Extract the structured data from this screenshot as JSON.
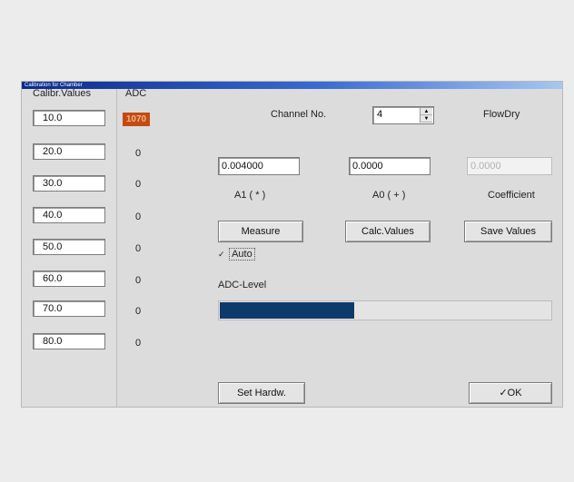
{
  "window": {
    "title": "Calibration for Chamber"
  },
  "left": {
    "header_calib": "Calibr.Values",
    "header_adc": "ADC",
    "calib_values": [
      "10.0",
      "20.0",
      "30.0",
      "40.0",
      "50.0",
      "60.0",
      "70.0",
      "80.0"
    ],
    "adc_values": [
      "1070",
      "0",
      "0",
      "0",
      "0",
      "0",
      "0",
      "0"
    ]
  },
  "channel": {
    "label": "Channel No.",
    "value": "4",
    "sensor": "FlowDry"
  },
  "coeffs": {
    "a1_value": "0.004000",
    "a0_value": "0.0000",
    "coef_value": "0.0000",
    "a1_label": "A1 ( * )",
    "a0_label": "A0 ( + )",
    "coef_label": "Coefficient"
  },
  "buttons": {
    "measure": "Measure",
    "calc": "Calc.Values",
    "save": "Save Values",
    "set_hardw": "Set Hardw.",
    "ok": "✓OK"
  },
  "auto": {
    "label": "Auto",
    "checked": "✓"
  },
  "adc_level": {
    "label": "ADC-Level",
    "fraction": 0.41
  },
  "colors": {
    "progress_fill": "#0d3a6b",
    "adc_highlight": "#c44a12",
    "title_bar": "#0a2a8a"
  }
}
